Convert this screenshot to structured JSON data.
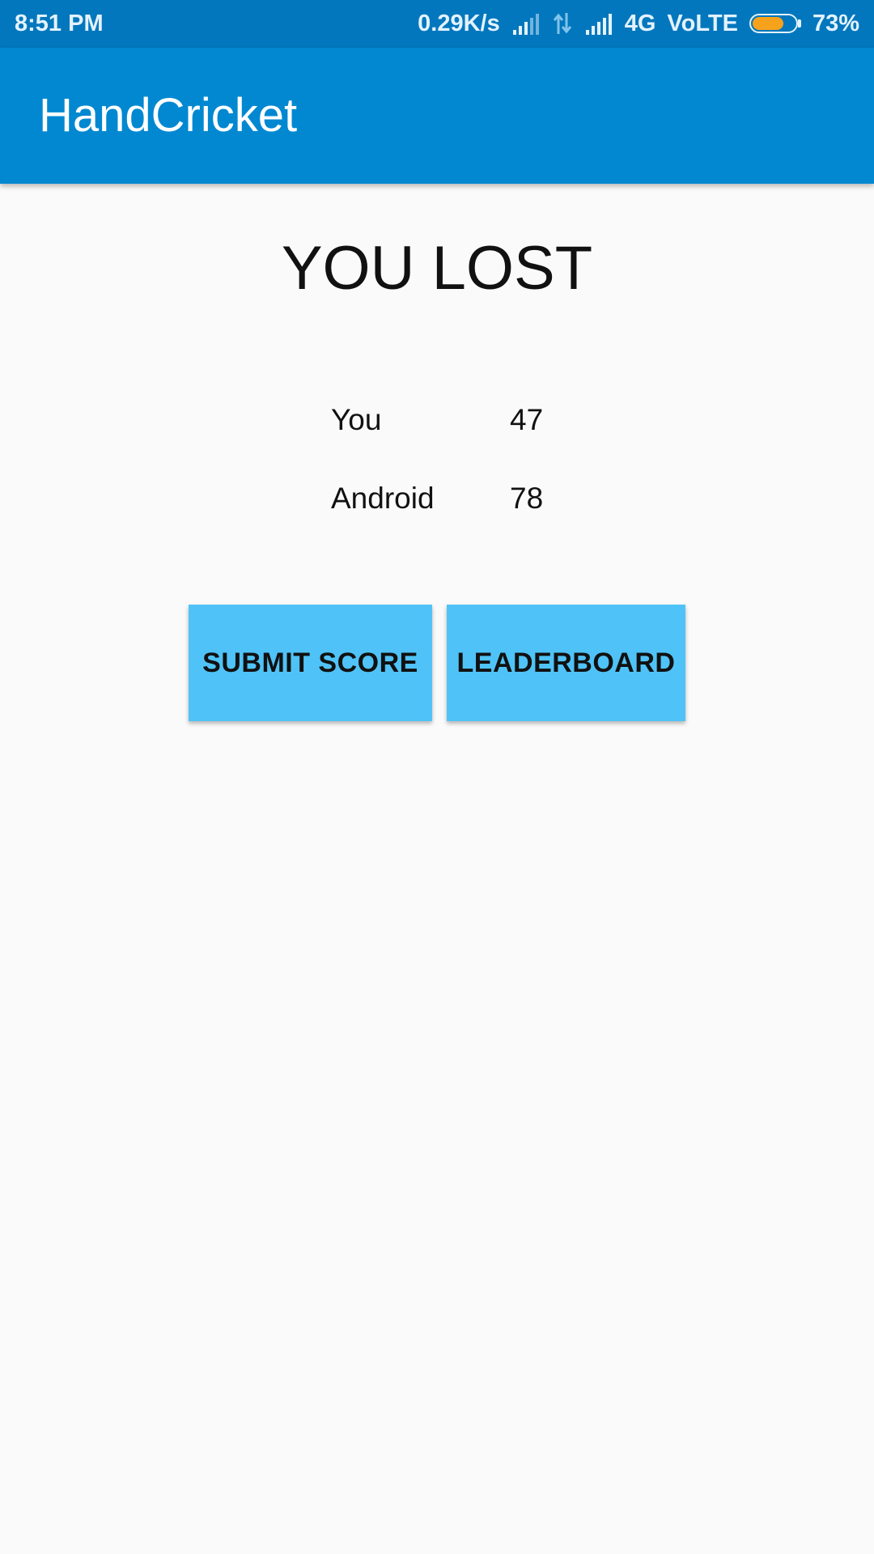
{
  "status_bar": {
    "time": "8:51 PM",
    "net_speed": "0.29K/s",
    "network_type": "4G",
    "volte": "VoLTE",
    "battery_percent_text": "73%",
    "battery_level": 0.73,
    "battery_color": "#f7a21c",
    "icons": [
      "signal-icon",
      "data-arrows-icon",
      "signal-icon",
      "battery-icon"
    ]
  },
  "app_bar": {
    "title": "HandCricket",
    "color": "#0288d1"
  },
  "result": {
    "heading": "YOU LOST"
  },
  "scores": [
    {
      "label": "You",
      "value": "47"
    },
    {
      "label": "Android",
      "value": "78"
    }
  ],
  "buttons": {
    "submit_label": "SUBMIT SCORE",
    "leaderboard_label": "LEADERBOARD",
    "color": "#4fc3f7"
  }
}
